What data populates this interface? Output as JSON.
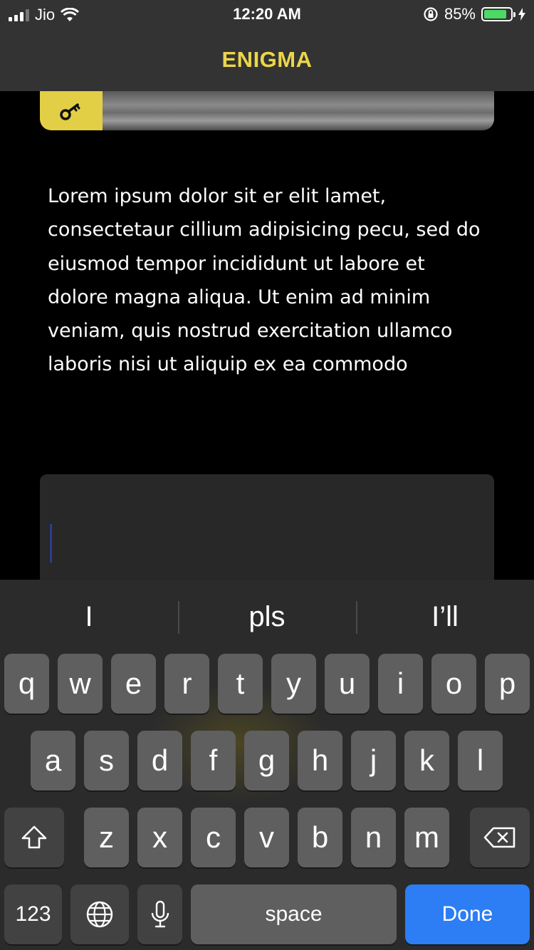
{
  "status_bar": {
    "carrier": "Jio",
    "time": "12:20 AM",
    "battery_percent": "85%",
    "battery_level": 0.85,
    "battery_color": "#4cd964"
  },
  "header": {
    "title": "ENIGMA",
    "title_color": "#ecd64a",
    "background": "#333333"
  },
  "card": {
    "key_icon": "key-icon",
    "accent": "#e2cf45"
  },
  "content": {
    "paragraph": "Lorem ipsum dolor sit er elit lamet, consectetaur cillium adipisicing pecu, sed do eiusmod tempor incididunt ut labore et dolore magna aliqua. Ut enim ad minim veniam, quis nostrud exercitation ullamco laboris nisi ut aliquip ex ea commodo"
  },
  "input": {
    "value": ""
  },
  "keyboard": {
    "suggestions": [
      "I",
      "pls",
      "I’ll"
    ],
    "row1": [
      "q",
      "w",
      "e",
      "r",
      "t",
      "y",
      "u",
      "i",
      "o",
      "p"
    ],
    "row2": [
      "a",
      "s",
      "d",
      "f",
      "g",
      "h",
      "j",
      "k",
      "l"
    ],
    "row3": [
      "z",
      "x",
      "c",
      "v",
      "b",
      "n",
      "m"
    ],
    "numbers_label": "123",
    "space_label": "space",
    "done_label": "Done",
    "done_color": "#2d7df4"
  }
}
